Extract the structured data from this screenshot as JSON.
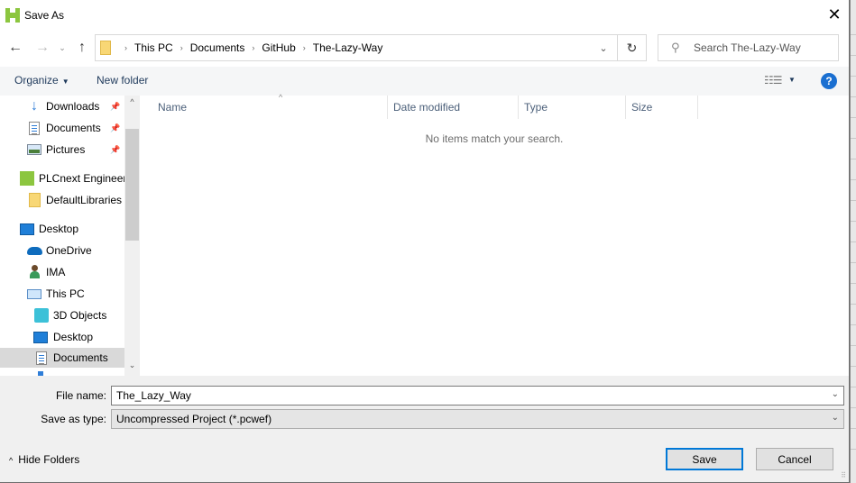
{
  "window": {
    "title": "Save As",
    "close_icon": "close-icon"
  },
  "navigation": {
    "back_icon": "arrow-left-icon",
    "forward_icon": "arrow-right-icon",
    "recent_icon": "chevron-down-icon",
    "up_icon": "arrow-up-icon"
  },
  "address_bar": {
    "crumbs": [
      "This PC",
      "Documents",
      "GitHub",
      "The-Lazy-Way"
    ],
    "separator": "›",
    "dropdown_icon": "chevron-down-icon",
    "refresh_icon": "refresh-icon"
  },
  "search": {
    "placeholder": "Search The-Lazy-Way"
  },
  "toolbar": {
    "organize_label": "Organize",
    "new_folder_label": "New folder",
    "view_icon": "view-details-icon",
    "help_label": "?"
  },
  "sidebar": {
    "items": [
      {
        "label": "Downloads",
        "icon": "download-icon",
        "pinned": true
      },
      {
        "label": "Documents",
        "icon": "document-icon",
        "pinned": true
      },
      {
        "label": "Pictures",
        "icon": "pictures-icon",
        "pinned": true
      },
      {
        "label": "PLCnext Engineer",
        "icon": "plcnext-icon",
        "pinned": false
      },
      {
        "label": "DefaultLibraries",
        "icon": "folder-icon",
        "pinned": false
      },
      {
        "label": "Desktop",
        "icon": "desktop-icon",
        "pinned": false
      },
      {
        "label": "OneDrive",
        "icon": "onedrive-icon",
        "pinned": false
      },
      {
        "label": "IMA",
        "icon": "user-icon",
        "pinned": false
      },
      {
        "label": "This PC",
        "icon": "computer-icon",
        "pinned": false
      },
      {
        "label": "3D Objects",
        "icon": "3d-objects-icon",
        "pinned": false
      },
      {
        "label": "Desktop",
        "icon": "desktop-icon",
        "pinned": false
      },
      {
        "label": "Documents",
        "icon": "document-icon",
        "pinned": false,
        "selected": true
      }
    ]
  },
  "file_list": {
    "columns": [
      "Name",
      "Date modified",
      "Type",
      "Size"
    ],
    "sorted_column": "Name",
    "empty_message": "No items match your search."
  },
  "form": {
    "file_name_label": "File name:",
    "file_name_value": "The_Lazy_Way",
    "save_type_label": "Save as type:",
    "save_type_value": "Uncompressed Project (*.pcwef)"
  },
  "footer": {
    "hide_folders_label": "Hide Folders",
    "save_label": "Save",
    "cancel_label": "Cancel"
  },
  "colors": {
    "accent": "#0078d7",
    "help_blue": "#1a6fd1",
    "link_text": "#1e395b",
    "selected_bg": "#d9d9d9"
  }
}
